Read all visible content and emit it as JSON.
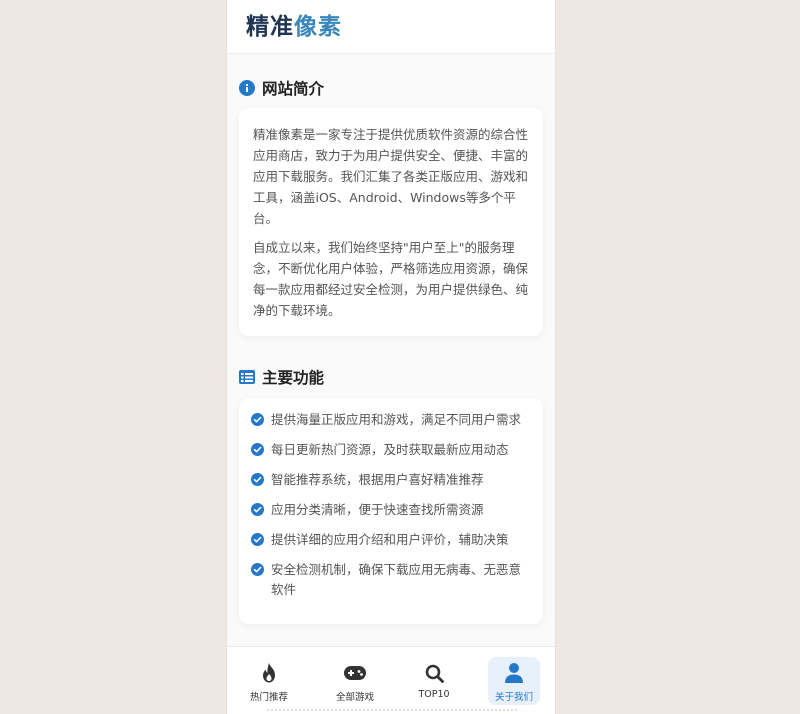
{
  "app": {
    "logo_part1": "精准",
    "logo_part2": "像素",
    "accent_color": "#2577c9"
  },
  "intro": {
    "title": "网站简介",
    "icon": "info-circle-icon",
    "paragraphs": [
      "精准像素是一家专注于提供优质软件资源的综合性应用商店，致力于为用户提供安全、便捷、丰富的应用下载服务。我们汇集了各类正版应用、游戏和工具，涵盖iOS、Android、Windows等多个平台。",
      "自成立以来，我们始终坚持\"用户至上\"的服务理念，不断优化用户体验，严格筛选应用资源，确保每一款应用都经过安全检测，为用户提供绿色、纯净的下载环境。"
    ]
  },
  "features": {
    "title": "主要功能",
    "icon": "list-icon",
    "items": [
      "提供海量正版应用和游戏，满足不同用户需求",
      "每日更新热门资源，及时获取最新应用动态",
      "智能推荐系统，根据用户喜好精准推荐",
      "应用分类清晰，便于快速查找所需资源",
      "提供详细的应用介绍和用户评价，辅助决策",
      "安全检测机制，确保下载应用无病毒、无恶意软件"
    ]
  },
  "nav": {
    "items": [
      {
        "label": "热门推荐",
        "icon": "fire-icon",
        "active": false
      },
      {
        "label": "全部游戏",
        "icon": "gamepad-icon",
        "active": false
      },
      {
        "label": "TOP10",
        "icon": "search-icon",
        "active": false
      },
      {
        "label": "关于我们",
        "icon": "user-icon",
        "active": true
      }
    ]
  }
}
